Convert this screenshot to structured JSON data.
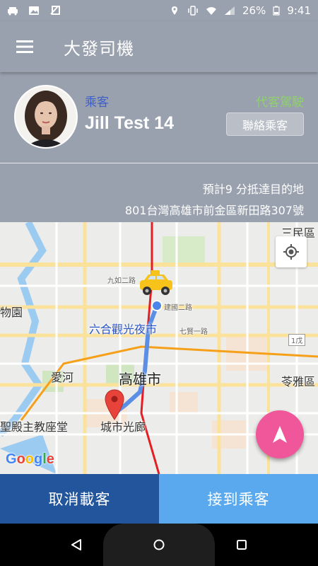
{
  "status_bar": {
    "battery": "26%",
    "time": "9:41"
  },
  "toolbar": {
    "title": "大發司機",
    "menu_icon": "hamburger-menu-icon"
  },
  "passenger": {
    "role_label": "乘客",
    "name": "Jill Test 14",
    "service_type": "代客駕駛",
    "contact_button": "聯絡乘客",
    "eta": "預計9 分抵達目的地",
    "address": "801台灣高雄市前金區新田路307號"
  },
  "map": {
    "labels": {
      "sanmin": "三民區",
      "jiuru": "九如二路",
      "jianguo": "建國二路",
      "liuhe_night_market": "六合觀光夜市",
      "qixian": "七賢一路",
      "zoo": "物園",
      "aihe": "愛河",
      "kaohsiung_city": "高雄市",
      "cathedral": "聖殿主教座堂",
      "city_gallery": "城市光廊",
      "lingya": "苓雅區",
      "route_1": "1戊"
    },
    "locate_icon": "gps-target-icon",
    "fab_icon": "navigation-arrow-icon",
    "google_logo": "Google"
  },
  "actions": {
    "cancel_label": "取消載客",
    "pickup_label": "接到乘客"
  },
  "colors": {
    "header": "#99a1ae",
    "cancel": "#22559b",
    "pickup": "#5aa9ef",
    "fab": "#f0579a",
    "role_label": "#3e5ecb",
    "service_type": "#8fd16a"
  }
}
